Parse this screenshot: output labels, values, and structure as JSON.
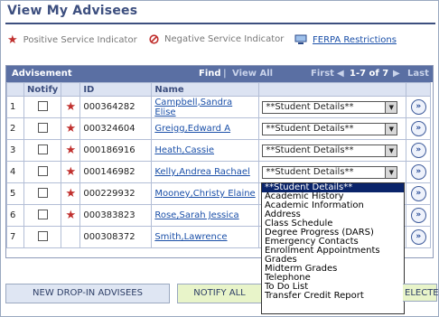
{
  "page_title": "View My Advisees",
  "legend": {
    "positive_label": "Positive Service Indicator",
    "negative_label": "Negative Service Indicator",
    "ferpa_label": "FERPA Restrictions"
  },
  "grid": {
    "title": "Advisement",
    "find": "Find",
    "view_all": "View All",
    "first": "First",
    "range": "1-7 of 7",
    "last": "Last",
    "col_notify": "Notify",
    "col_id": "ID",
    "col_name": "Name",
    "rows": [
      {
        "num": "1",
        "star": true,
        "id": "000364282",
        "name": "Campbell,Sandra Elise",
        "action": "**Student Details**"
      },
      {
        "num": "2",
        "star": true,
        "id": "000324604",
        "name": "Greigg,Edward A",
        "action": "**Student Details**"
      },
      {
        "num": "3",
        "star": true,
        "id": "000186916",
        "name": "Heath,Cassie",
        "action": "**Student Details**"
      },
      {
        "num": "4",
        "star": true,
        "id": "000146982",
        "name": "Kelly,Andrea Rachael",
        "action": "**Student Details**"
      },
      {
        "num": "5",
        "star": true,
        "id": "000229932",
        "name": "Mooney,Christy Elaine",
        "action": ""
      },
      {
        "num": "6",
        "star": true,
        "id": "000383823",
        "name": "Rose,Sarah Jessica",
        "action": ""
      },
      {
        "num": "7",
        "star": false,
        "id": "000308372",
        "name": "Smith,Lawrence",
        "action": ""
      }
    ]
  },
  "dropdown_options": [
    "**Student Details**",
    "Academic History",
    "Academic Information",
    "Address",
    "Class Schedule",
    "Degree Progress (DARS)",
    "Emergency Contacts",
    "Enrollment Appointments",
    "Grades",
    "Midterm Grades",
    "Telephone",
    "To Do List",
    "Transfer Credit Report"
  ],
  "buttons": {
    "new_dropin": "NEW DROP-IN ADVISEES",
    "notify_all": "NOTIFY ALL",
    "notify_selected_fragment": "ELECTE"
  },
  "colors": {
    "brand": "#3d4f7f",
    "grid_header": "#5a6fa3",
    "star": "#c0302e",
    "link": "#1a4fa8"
  }
}
